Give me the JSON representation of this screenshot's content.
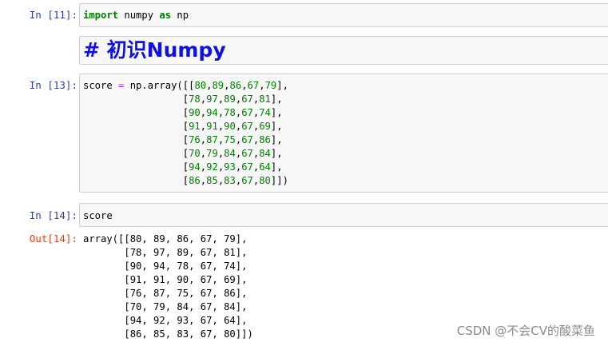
{
  "cells": {
    "c11": {
      "prompt": "In  [11]:",
      "import_kw": "import",
      "module": " numpy ",
      "as_kw": "as",
      "alias": " np"
    },
    "md": {
      "heading": "# 初识Numpy"
    },
    "c13": {
      "prompt": "In  [13]:",
      "var": "score ",
      "eq": "=",
      "call_prefix": " np.array([",
      "rows": [
        "[80,89,86,67,79]",
        "[78,97,89,67,81]",
        "[90,94,78,67,74]",
        "[91,91,90,67,69]",
        "[76,87,75,67,86]",
        "[70,79,84,67,84]",
        "[94,92,93,67,64]",
        "[86,85,83,67,80]"
      ]
    },
    "c14": {
      "prompt": "In  [14]:",
      "code": "score",
      "out_prompt": "Out[14]:",
      "output_lines": [
        "array([[80, 89, 86, 67, 79],",
        "       [78, 97, 89, 67, 81],",
        "       [90, 94, 78, 67, 74],",
        "       [91, 91, 90, 67, 69],",
        "       [76, 87, 75, 67, 86],",
        "       [70, 79, 84, 67, 84],",
        "       [94, 92, 93, 67, 64],",
        "       [86, 85, 83, 67, 80]])"
      ]
    }
  },
  "watermark": "CSDN @不会CV的酸菜鱼",
  "colors": {
    "keyword": "#008000",
    "operator": "#aa22ff",
    "number": "#008000",
    "in_prompt": "#303f9f",
    "out_prompt": "#d84315",
    "heading": "#1010e0"
  }
}
